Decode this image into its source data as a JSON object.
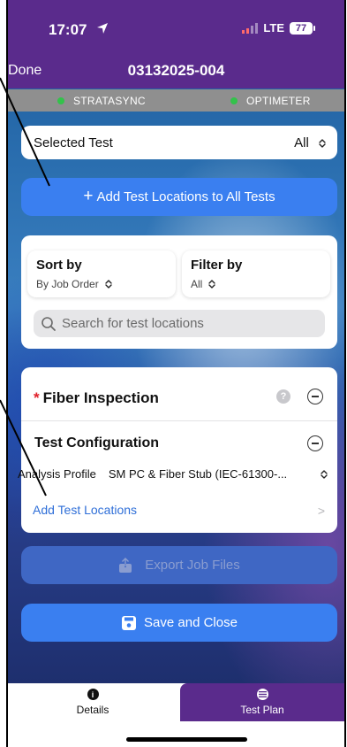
{
  "status_bar": {
    "time": "17:07",
    "network": "LTE",
    "battery": "77"
  },
  "nav": {
    "done_label": "Done",
    "title": "03132025-004"
  },
  "connections": {
    "stratasync_label": "STRATASYNC",
    "optimeter_label": "OPTIMETER",
    "status_color": "#33c24b"
  },
  "selected_test": {
    "label": "Selected Test",
    "value": "All"
  },
  "add_all_button": {
    "plus": "+",
    "label": "Add Test Locations to All Tests"
  },
  "sort": {
    "title": "Sort by",
    "value": "By Job Order"
  },
  "filter": {
    "title": "Filter by",
    "value": "All"
  },
  "search": {
    "placeholder": "Search for test locations"
  },
  "fiber_inspection": {
    "required_mark": "*",
    "title": "Fiber Inspection",
    "help": "?",
    "config_title": "Test Configuration",
    "analysis_label": "Analysis Profile",
    "analysis_value": "SM PC & Fiber Stub (IEC-61300-...",
    "add_locations_label": "Add Test Locations",
    "chevron": ">"
  },
  "export_button": {
    "label": "Export Job Files"
  },
  "save_button": {
    "label": "Save and Close"
  },
  "tabs": [
    {
      "label": "Details",
      "icon": "info-icon",
      "active": false
    },
    {
      "label": "Test Plan",
      "icon": "list-icon",
      "active": true
    }
  ],
  "colors": {
    "accent_purple": "#5a2b8c",
    "button_blue": "#3a7ff0",
    "link_blue": "#2f6fd8",
    "required_red": "#e0202a"
  }
}
